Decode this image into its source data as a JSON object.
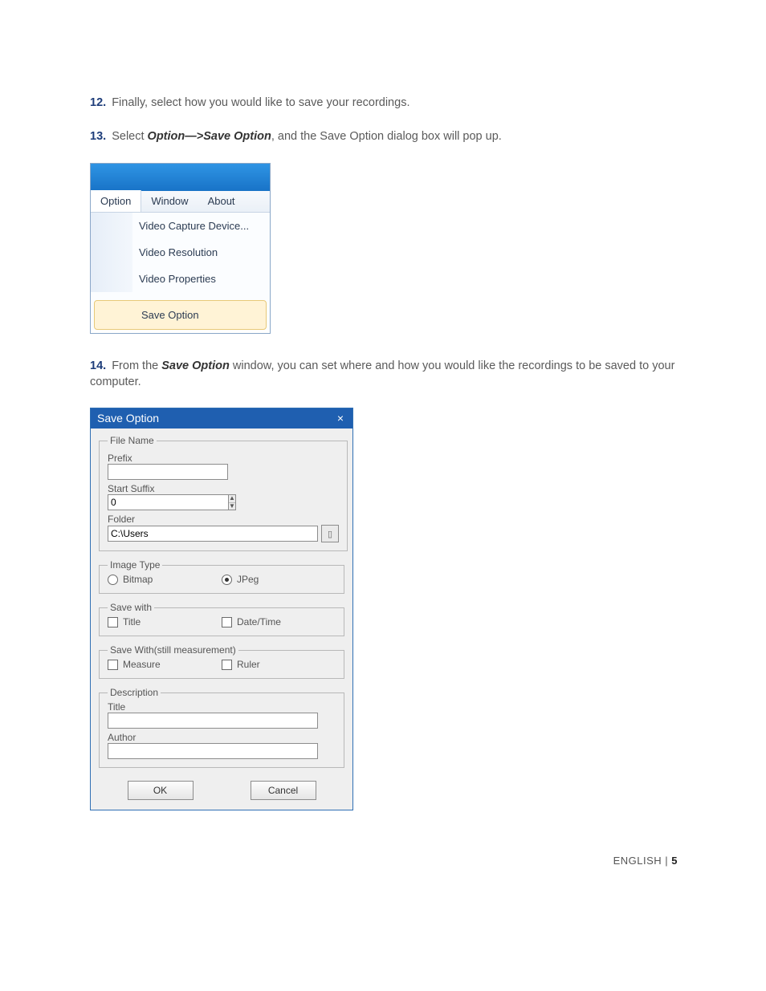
{
  "instructions": {
    "i12": {
      "num": "12.",
      "text": "Finally, select how you would like to save your recordings."
    },
    "i13": {
      "num": "13.",
      "pre": "Select ",
      "bold": "Option—>Save Option",
      "post": ", and the Save Option dialog box will pop up."
    },
    "i14": {
      "num": "14.",
      "pre": "From the ",
      "bold": "Save Option",
      "post": " window, you can set where and how you would like the recordings to be saved to your computer."
    }
  },
  "menu": {
    "items": {
      "option": "Option",
      "window": "Window",
      "about": "About"
    },
    "dropdown": {
      "video_capture": "Video Capture Device...",
      "video_resolution": "Video Resolution",
      "video_properties": "Video Properties",
      "save_option": "Save Option"
    }
  },
  "dialog": {
    "title": "Save Option",
    "close": "×",
    "file_name": {
      "legend": "File Name",
      "prefix_label": "Prefix",
      "prefix_value": "",
      "suffix_label": "Start Suffix",
      "suffix_value": "0",
      "folder_label": "Folder",
      "folder_value": "C:\\Users"
    },
    "image_type": {
      "legend": "Image Type",
      "bitmap": "Bitmap",
      "jpeg": "JPeg"
    },
    "save_with": {
      "legend": "Save with",
      "title": "Title",
      "datetime": "Date/Time"
    },
    "save_with_still": {
      "legend": "Save With(still measurement)",
      "measure": "Measure",
      "ruler": "Ruler"
    },
    "description": {
      "legend": "Description",
      "title_label": "Title",
      "title_value": "",
      "author_label": "Author",
      "author_value": ""
    },
    "buttons": {
      "ok": "OK",
      "cancel": "Cancel"
    }
  },
  "footer": {
    "lang": "ENGLISH",
    "sep": " | ",
    "page": "5"
  }
}
